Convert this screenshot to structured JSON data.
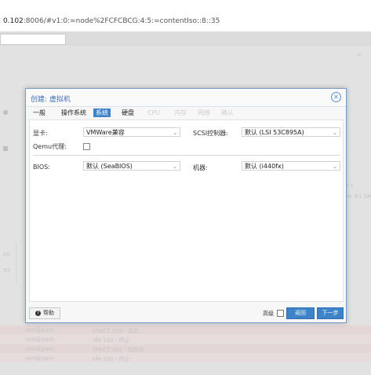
{
  "browser": {
    "url_host": "0.102",
    "url_rest": ":8006/#v1:0:=node%2FCFCBCG:4:5:=contentIso::8::35"
  },
  "background": {
    "rows": [
      {
        "user": "root@pam",
        "desc": "VM/CT 100 - 启动"
      },
      {
        "user": "root@pam",
        "desc": "VM 100 - 停止"
      },
      {
        "user": "root@pam",
        "desc": "VM/CT 100 - 控制台"
      },
      {
        "user": "root@pam",
        "desc": "VM 100 - 停止"
      }
    ],
    "side_values": [
      "2 x",
      "ne #1 SMP"
    ],
    "chart_ticks": [
      "60",
      "50"
    ]
  },
  "dialog": {
    "title": "创建: 虚拟机",
    "tabs": [
      {
        "label": "一般",
        "state": "normal"
      },
      {
        "label": "操作系统",
        "state": "normal"
      },
      {
        "label": "系统",
        "state": "active"
      },
      {
        "label": "硬盘",
        "state": "normal"
      },
      {
        "label": "CPU",
        "state": "disabled"
      },
      {
        "label": "内存",
        "state": "disabled"
      },
      {
        "label": "网络",
        "state": "disabled"
      },
      {
        "label": "确认",
        "state": "disabled"
      }
    ],
    "graphics_label": "显卡:",
    "graphics_value": "VMWare兼容",
    "scsi_label": "SCSI控制器:",
    "scsi_value": "默认 (LSI 53C895A)",
    "qemu_label": "Qemu代理:",
    "qemu_checked": false,
    "bios_label": "BIOS:",
    "bios_value": "默认 (SeaBIOS)",
    "machine_label": "机器:",
    "machine_value": "默认 (i440fx)",
    "help_label": "帮助",
    "advanced_label": "高级",
    "advanced_checked": false,
    "back_label": "返回",
    "next_label": "下一步"
  }
}
